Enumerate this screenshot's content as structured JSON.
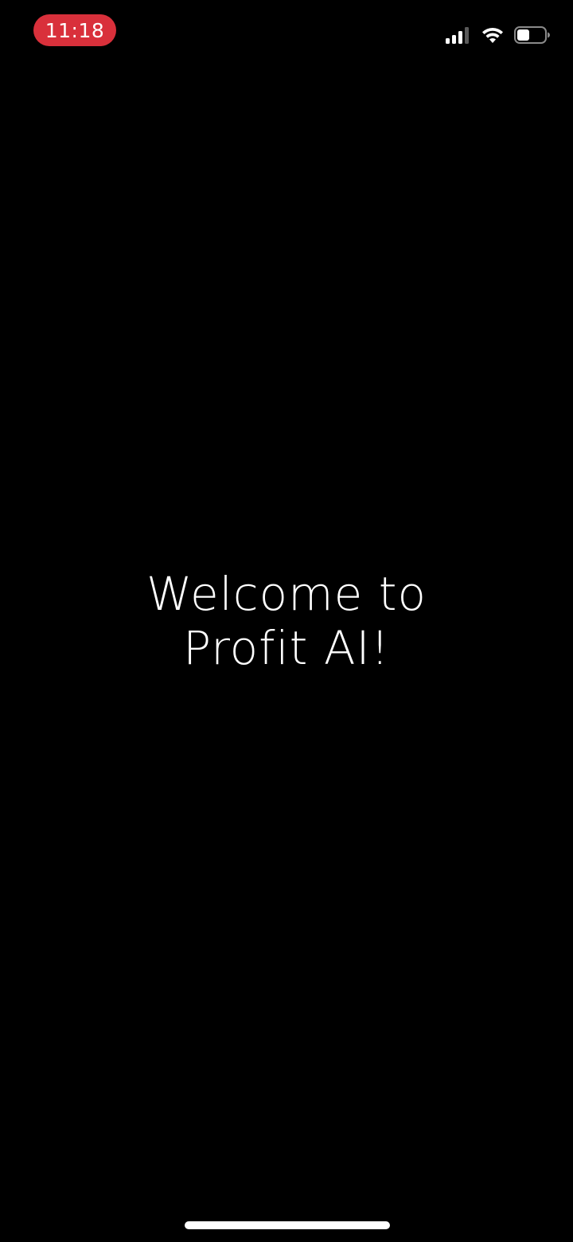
{
  "status_bar": {
    "time": "11:18",
    "time_pill_color": "#d9303b",
    "icons": [
      "cellular-signal-icon",
      "wifi-icon",
      "battery-icon"
    ]
  },
  "welcome": {
    "line1": "Welcome to",
    "line2": "Profit AI!"
  },
  "colors": {
    "background": "#000000",
    "text": "#ffffff"
  }
}
